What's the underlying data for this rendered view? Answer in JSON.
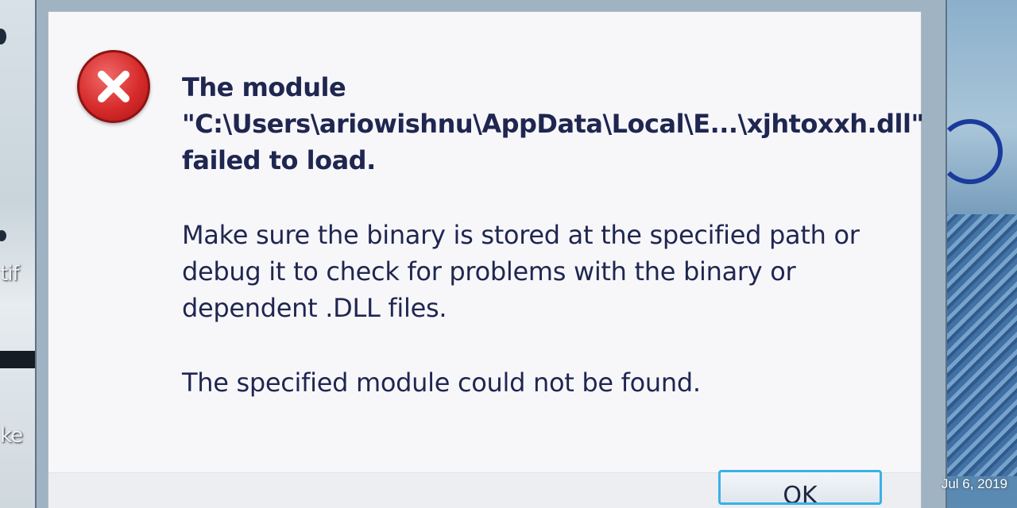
{
  "dialog": {
    "icon": "error-x-icon",
    "heading_lines": [
      "The module",
      "\"C:\\Users\\ariowishnu\\AppData\\Local\\E...\\xjhtoxxh.dll\"",
      "failed to load."
    ],
    "body_lines": [
      "Make sure the binary is stored at the specified path or",
      "debug it to check for problems with the binary or",
      "dependent .DLL files."
    ],
    "detail": "The specified module could not be found.",
    "ok_label": "OK"
  },
  "desktop": {
    "left_fragments": [
      "tif",
      "ke"
    ]
  },
  "photo": {
    "date": "Jul 6, 2019"
  },
  "colors": {
    "text": "#1f2650",
    "error_red": "#d72b2b",
    "button_focus": "#3ab0e6"
  }
}
